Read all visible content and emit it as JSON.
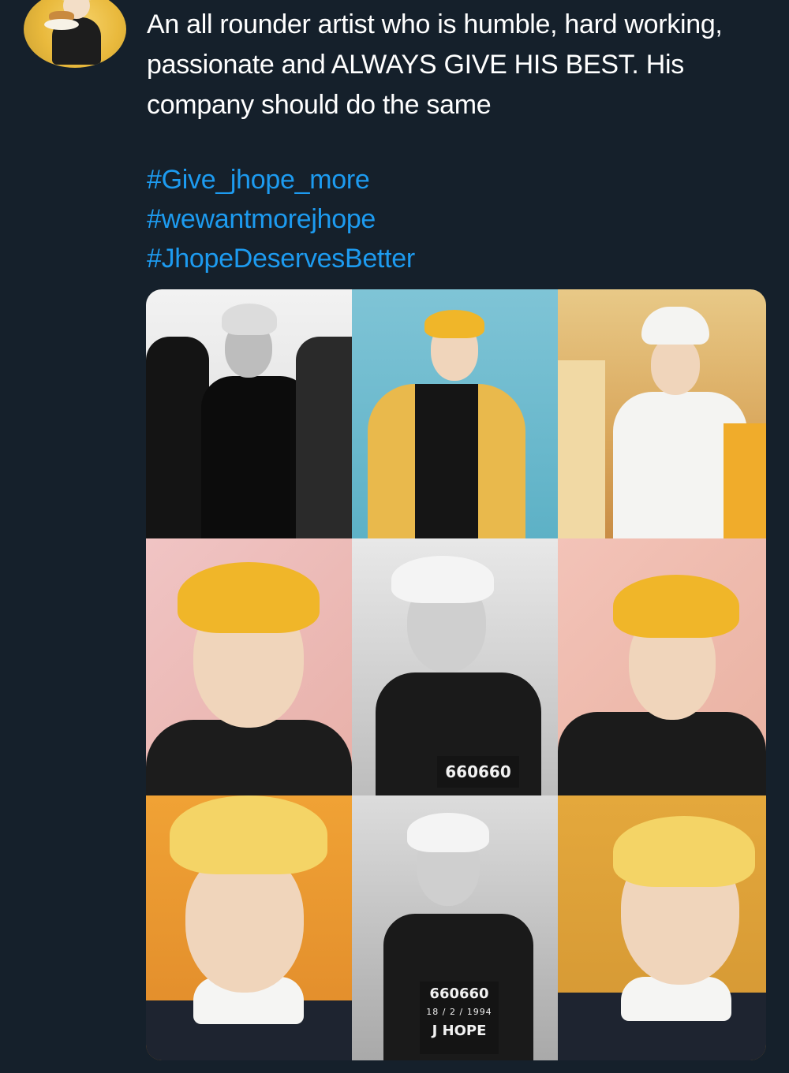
{
  "tweet": {
    "body": "An all rounder artist who is humble, hard working, passionate and ALWAYS GIVE HIS BEST. His company should do the same",
    "hashtags": [
      "#Give_jhope_more",
      "#wewantmorejhope",
      "#JhopeDeservesBetter"
    ]
  },
  "media": {
    "photos": [
      {
        "label": ""
      },
      {
        "label": ""
      },
      {
        "label": ""
      },
      {
        "label": ""
      },
      {
        "label": "660660"
      },
      {
        "label": ""
      },
      {
        "label": ""
      },
      {
        "label": "660660",
        "date": "18 / 2 / 1994",
        "name": "J HOPE"
      },
      {
        "label": ""
      }
    ]
  },
  "colors": {
    "background": "#15202b",
    "text": "#ffffff",
    "link": "#1d9bf0"
  }
}
